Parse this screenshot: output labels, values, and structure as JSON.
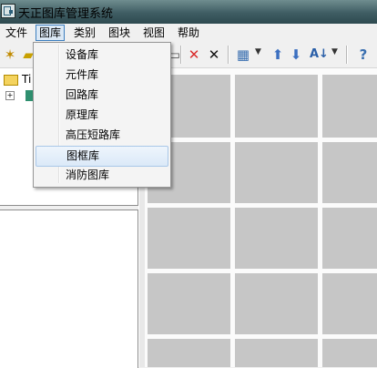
{
  "window": {
    "title": "天正图库管理系统"
  },
  "menubar": {
    "items": [
      "文件",
      "图库",
      "类别",
      "图块",
      "视图",
      "帮助"
    ],
    "active": "图库"
  },
  "dropdown": {
    "items": [
      "设备库",
      "元件库",
      "回路库",
      "原理库",
      "高压短路库",
      "图框库",
      "消防图库"
    ],
    "highlighted": "图框库"
  },
  "tree": {
    "root_label": "Ti"
  },
  "toolbar": {
    "icons": [
      "new-icon",
      "open-icon",
      "delete-red-icon",
      "delete-black-icon",
      "view-icon",
      "up-arrow-icon",
      "down-arrow-icon",
      "sort-az-icon",
      "help-icon"
    ]
  },
  "colors": {
    "titlebar": "#3f5d63",
    "grid_cell": "#c6c6c6",
    "highlight": "#dbe9f8",
    "delete": "#d92b2b"
  }
}
